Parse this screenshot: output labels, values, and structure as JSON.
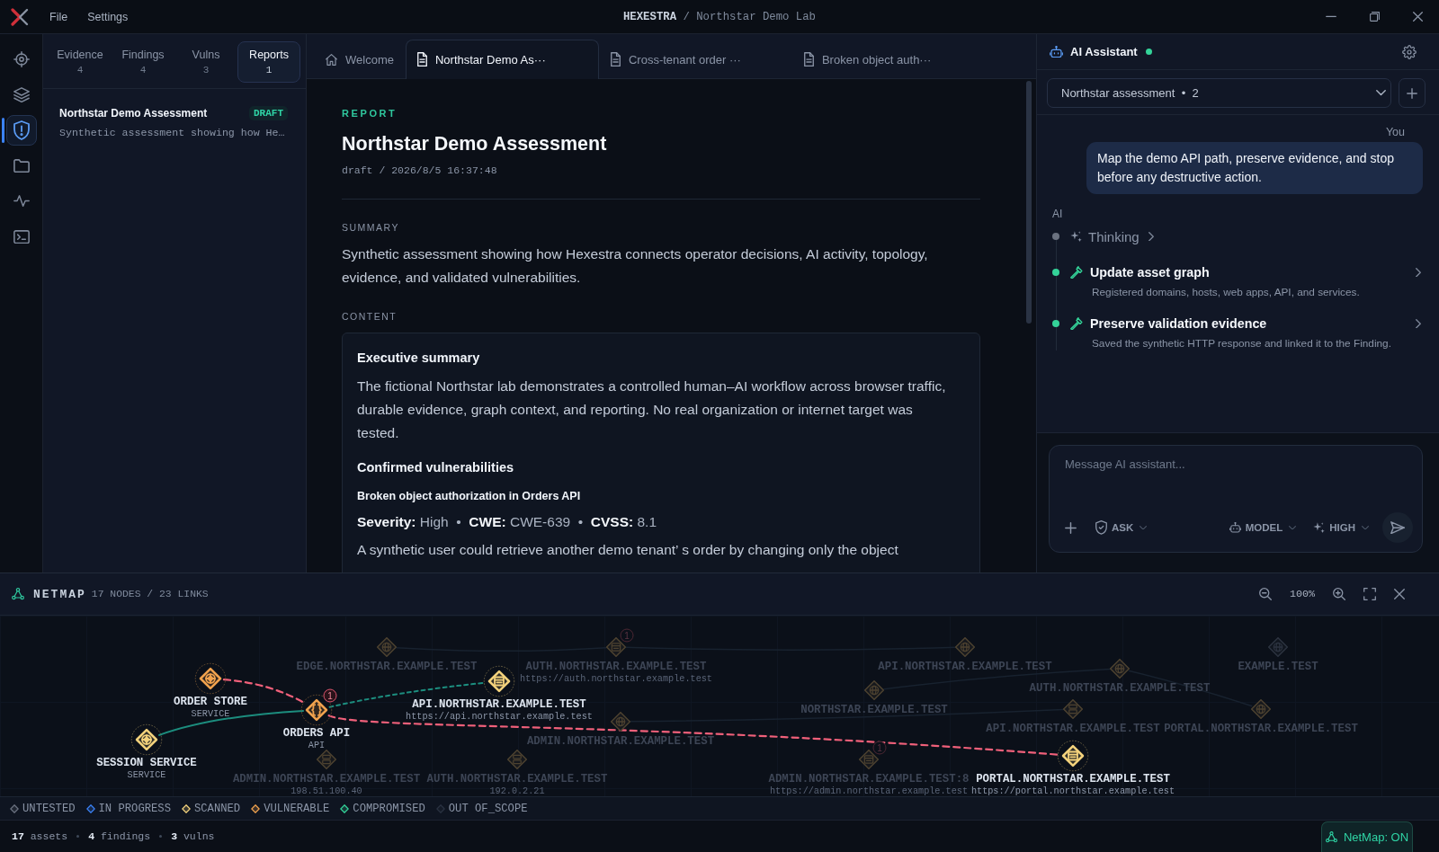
{
  "window": {
    "title": "**HEXESTRA** / Northstar Demo Lab",
    "menu": [
      "File",
      "Settings"
    ]
  },
  "activity_bar": [
    {
      "kind": "target",
      "selected": false
    },
    {
      "kind": "layers",
      "selected": false
    },
    {
      "kind": "shield",
      "selected": true
    },
    {
      "kind": "folder",
      "selected": false
    },
    {
      "kind": "pulse",
      "selected": false
    },
    {
      "kind": "terminal",
      "selected": false
    }
  ],
  "side_tabs": [
    {
      "label": "Evidence",
      "count": "4",
      "selected": false
    },
    {
      "label": "Findings",
      "count": "4",
      "selected": false
    },
    {
      "label": "Vulns",
      "count": "3",
      "selected": false
    },
    {
      "label": "Reports",
      "count": "1",
      "selected": true
    }
  ],
  "reports": [
    {
      "title": "Northstar Demo Assessment",
      "status": "DRAFT",
      "excerpt": "Synthetic assessment showing how He…"
    }
  ],
  "editor_tabs": [
    {
      "kind": "home",
      "label": "Welcome",
      "selected": false
    },
    {
      "kind": "document",
      "label": "Northstar Demo As···",
      "selected": true
    },
    {
      "kind": "document",
      "label": "Cross-tenant order ···",
      "selected": false
    },
    {
      "kind": "document",
      "label": "Broken object auth···",
      "selected": false
    }
  ],
  "report": {
    "eyebrow": "REPORT",
    "title": "Northstar Demo Assessment",
    "meta": "draft / 2026/8/5 16:37:48",
    "summary_heading": "SUMMARY",
    "summary": "Synthetic assessment showing how Hexestra connects operator decisions, AI activity, topology, evidence, and validated vulnerabilities.",
    "content_heading": "CONTENT",
    "content": [
      {
        "kind": "heading",
        "text": "Executive summary"
      },
      {
        "kind": "paragraph",
        "text": "The fictional Northstar lab demonstrates a controlled human–AI workflow across browser traffic, durable evidence, graph context, and reporting. No real organization or internet target was tested."
      },
      {
        "kind": "heading",
        "text": "Confirmed vulnerabilities"
      },
      {
        "kind": "subheading",
        "text": "Broken object authorization in Orders API"
      },
      {
        "kind": "facts",
        "text": "**Severity:** High  •  **CWE:** CWE-639  •  **CVSS:** 8.1"
      },
      {
        "kind": "paragraph",
        "text": "A synthetic user could retrieve another demo tenant’ s order by changing only the object"
      }
    ]
  },
  "assistant": {
    "title": "AI Assistant",
    "online": true,
    "session": "Northstar assessment  •  2",
    "user_label": "You",
    "user_message": "Map the demo API path, preserve evidence, and stop before any destructive action.",
    "ai_label": "AI",
    "steps": [
      {
        "kind": "thinking",
        "title": "Thinking",
        "done": false
      },
      {
        "kind": "tool",
        "title": "Update asset graph",
        "detail": "Registered domains, hosts, web apps, API, and services.",
        "done": true
      },
      {
        "kind": "tool",
        "title": "Preserve validation evidence",
        "detail": "Saved the synthetic HTTP response and linked it to the Finding.",
        "done": true
      }
    ],
    "composer": {
      "placeholder": "Message AI assistant...",
      "mode": "ASK",
      "model": "MODEL",
      "effort": "HIGH"
    }
  },
  "netmap": {
    "title": "NETMAP",
    "stats": "17 NODES / 23 LINKS",
    "zoom": "100%",
    "nodes": [
      {
        "label": "ORDER STORE",
        "sublabel": "SERVICE",
        "kind": "service",
        "color": "#f0a24e",
        "dimmed": false
      },
      {
        "label": "SESSION SERVICE",
        "sublabel": "SERVICE",
        "kind": "service",
        "color": "#f3d27c",
        "dimmed": false
      },
      {
        "label": "ORDERS API",
        "sublabel": "API",
        "kind": "api",
        "color": "#f0a24e",
        "dimmed": false,
        "badge": "1"
      },
      {
        "label": "API.NORTHSTAR.EXAMPLE.TEST",
        "sublabel": "https://api.northstar.example.test",
        "kind": "web",
        "color": "#f3d27c",
        "dimmed": false
      },
      {
        "label": "EDGE.NORTHSTAR.EXAMPLE.TEST",
        "kind": "domain",
        "color": "#4d4230",
        "dimmed": true
      },
      {
        "label": "AUTH.NORTHSTAR.EXAMPLE.TEST",
        "sublabel": "https://auth.northstar.example.test",
        "kind": "web",
        "color": "#4d4230",
        "dimmed": true,
        "badge": "1"
      },
      {
        "label": "ADMIN.NORTHSTAR.EXAMPLE.TEST",
        "kind": "domain",
        "color": "#4d4230",
        "dimmed": true
      },
      {
        "label": "ADMIN.NORTHSTAR.EXAMPLE.TEST",
        "sublabel": "198.51.100.40",
        "kind": "host",
        "color": "#4d4230",
        "dimmed": true
      },
      {
        "label": "AUTH.NORTHSTAR.EXAMPLE.TEST",
        "sublabel": "192.0.2.21",
        "kind": "host",
        "color": "#4d4230",
        "dimmed": true
      },
      {
        "label": "API.NORTHSTAR.EXAMPLE.TEST",
        "kind": "domain",
        "color": "#4d4230",
        "dimmed": true
      },
      {
        "label": "NORTHSTAR.EXAMPLE.TEST",
        "kind": "domain",
        "color": "#4d4230",
        "dimmed": true
      },
      {
        "label": "AUTH.NORTHSTAR.EXAMPLE.TEST",
        "kind": "domain",
        "color": "#4d4230",
        "dimmed": true
      },
      {
        "label": "EXAMPLE.TEST",
        "kind": "domain",
        "color": "#2c3340",
        "dimmed": true
      },
      {
        "label": "API.NORTHSTAR.EXAMPLE.TEST",
        "kind": "host",
        "color": "#4d4230",
        "dimmed": true
      },
      {
        "label": "PORTAL.NORTHSTAR.EXAMPLE.TEST",
        "kind": "domain",
        "color": "#4d4230",
        "dimmed": true
      },
      {
        "label": "ADMIN.NORTHSTAR.EXAMPLE.TEST:8",
        "sublabel": "https://admin.northstar.example.test",
        "kind": "web",
        "color": "#4d4230",
        "dimmed": true,
        "badge": "1"
      },
      {
        "label": "PORTAL.NORTHSTAR.EXAMPLE.TEST",
        "sublabel": "https://portal.northstar.example.test",
        "kind": "web",
        "color": "#f3d27c",
        "dimmed": false
      }
    ],
    "links": [
      {
        "kind": "attack"
      },
      {
        "kind": "attack"
      },
      {
        "kind": "traffic"
      },
      {
        "kind": "probe"
      },
      {
        "kind": "dimmed"
      },
      {
        "kind": "dimmed"
      },
      {
        "kind": "dimmed"
      },
      {
        "kind": "dimmed"
      },
      {
        "kind": "dimmed"
      }
    ],
    "legend": [
      {
        "label": "UNTESTED",
        "color": "#6b7280"
      },
      {
        "label": "IN PROGRESS",
        "color": "#3b82f6"
      },
      {
        "label": "SCANNED",
        "color": "#f3d27c"
      },
      {
        "label": "VULNERABLE",
        "color": "#f0a24e"
      },
      {
        "label": "COMPROMISED",
        "color": "#34d399"
      },
      {
        "label": "OUT OF_SCOPE",
        "color": "#2b3342"
      }
    ]
  },
  "status_bar": {
    "counts": [
      "**17** assets",
      "**4** findings",
      "**3** vulns"
    ],
    "netmap_toggle": "NetMap: ON"
  }
}
